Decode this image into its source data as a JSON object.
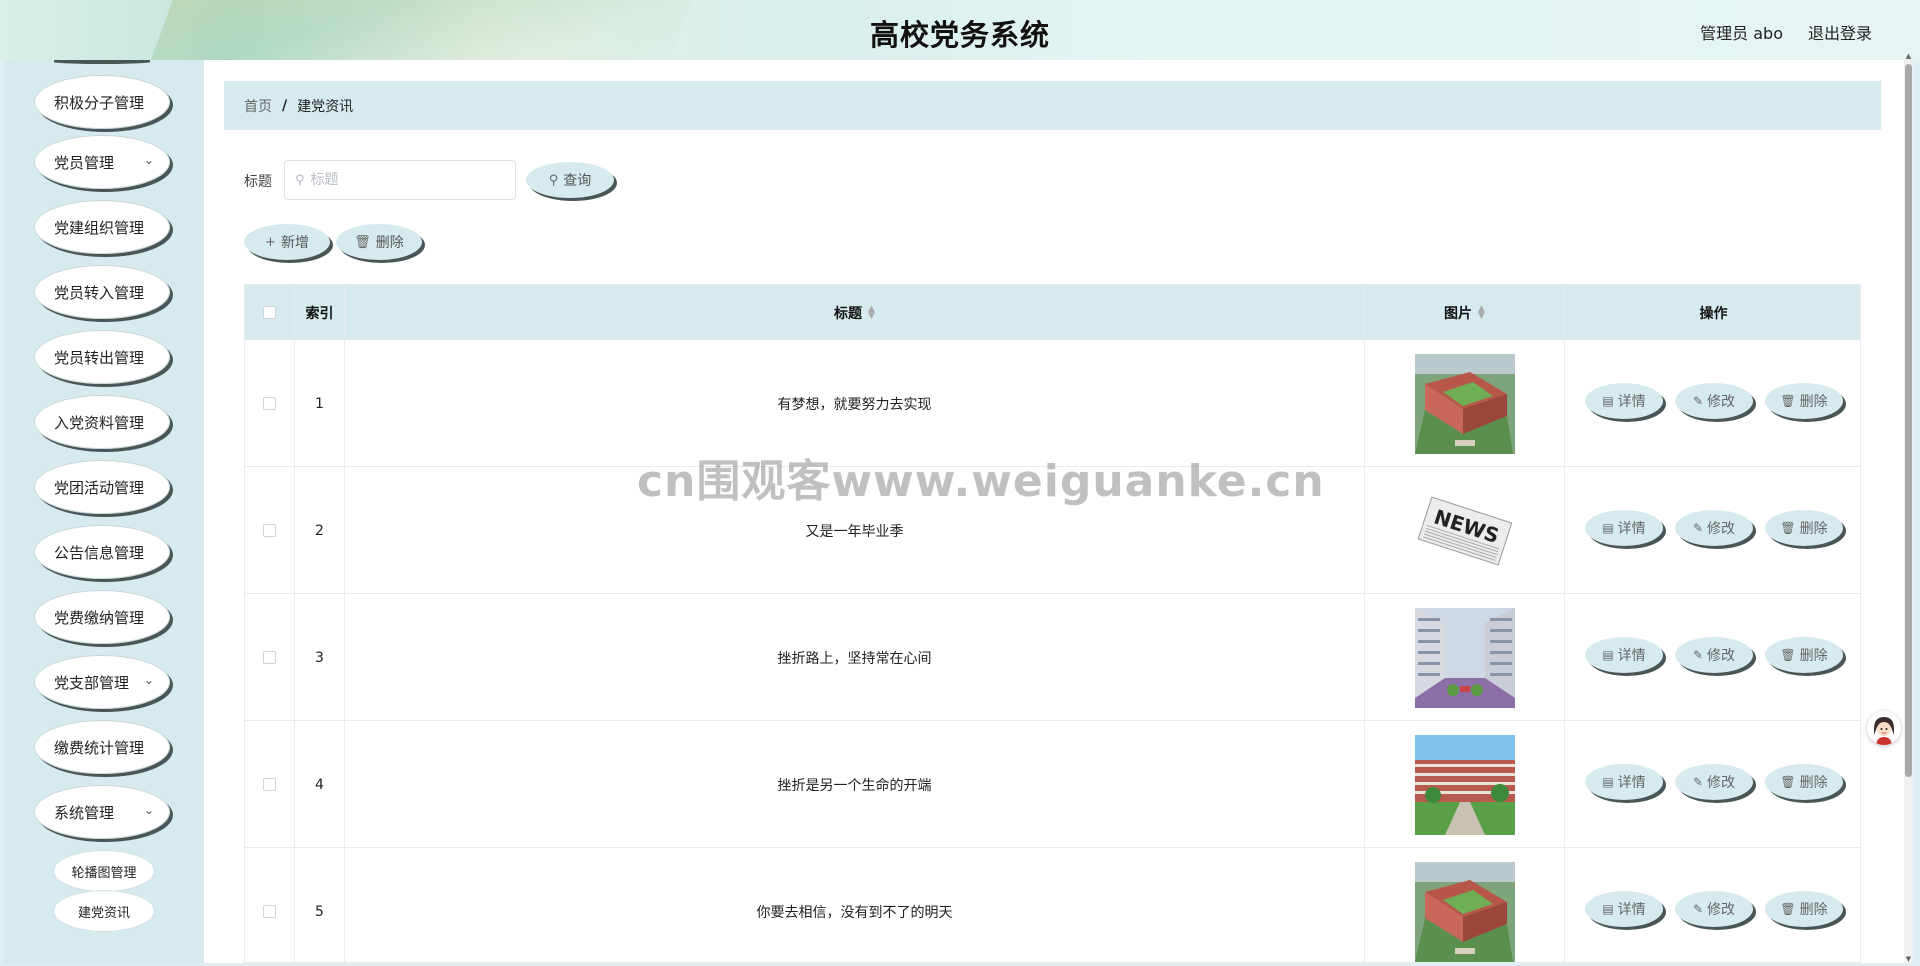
{
  "header": {
    "title": "高校党务系统",
    "user": "管理员 abo",
    "logout": "退出登录"
  },
  "sidebar": {
    "items": [
      {
        "label": "积极分子管理",
        "has_chevron": false
      },
      {
        "label": "党员管理",
        "has_chevron": true
      },
      {
        "label": "党建组织管理",
        "has_chevron": false
      },
      {
        "label": "党员转入管理",
        "has_chevron": false
      },
      {
        "label": "党员转出管理",
        "has_chevron": false
      },
      {
        "label": "入党资料管理",
        "has_chevron": false
      },
      {
        "label": "党团活动管理",
        "has_chevron": false
      },
      {
        "label": "公告信息管理",
        "has_chevron": false
      },
      {
        "label": "党费缴纳管理",
        "has_chevron": false
      },
      {
        "label": "党支部管理",
        "has_chevron": true
      },
      {
        "label": "缴费统计管理",
        "has_chevron": false
      },
      {
        "label": "系统管理",
        "has_chevron": true
      }
    ],
    "subitems": [
      {
        "label": "轮播图管理"
      },
      {
        "label": "建党资讯"
      }
    ]
  },
  "breadcrumb": {
    "home": "首页",
    "separator": "/",
    "current": "建党资讯"
  },
  "search": {
    "label": "标题",
    "placeholder": "标题",
    "value": "",
    "query_button": "查询"
  },
  "actions": {
    "add": "新增",
    "delete": "删除"
  },
  "table": {
    "columns": [
      "索引",
      "标题",
      "图片",
      "操作"
    ],
    "rows": [
      {
        "index": "1",
        "title": "有梦想，就要努力去实现",
        "image": "campus-aerial"
      },
      {
        "index": "2",
        "title": "又是一年毕业季",
        "image": "newspaper"
      },
      {
        "index": "3",
        "title": "挫折路上，坚持常在心间",
        "image": "campus-courtyard"
      },
      {
        "index": "4",
        "title": "挫折是另一个生命的开端",
        "image": "campus-building"
      },
      {
        "index": "5",
        "title": "你要去相信，没有到不了的明天",
        "image": "campus-aerial"
      }
    ],
    "row_actions": {
      "detail": "详情",
      "edit": "修改",
      "delete": "删除"
    }
  },
  "watermark": "cn围观客www.weiguanke.cn",
  "colors": {
    "accent": "#d7ebee",
    "shadow": "#4a5656"
  }
}
